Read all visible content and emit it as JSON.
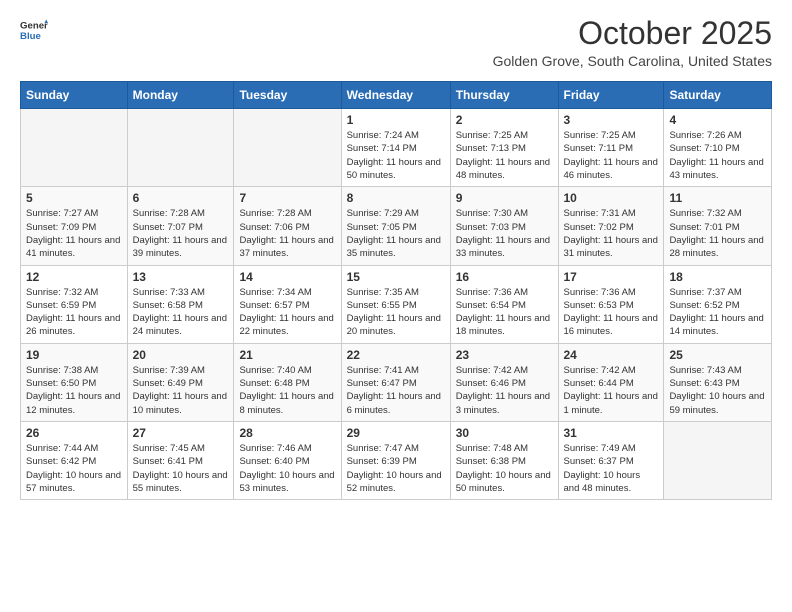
{
  "header": {
    "logo_general": "General",
    "logo_blue": "Blue",
    "title": "October 2025",
    "subtitle": "Golden Grove, South Carolina, United States"
  },
  "weekdays": [
    "Sunday",
    "Monday",
    "Tuesday",
    "Wednesday",
    "Thursday",
    "Friday",
    "Saturday"
  ],
  "weeks": [
    [
      {
        "day": "",
        "sunrise": "",
        "sunset": "",
        "daylight": "",
        "empty": true
      },
      {
        "day": "",
        "sunrise": "",
        "sunset": "",
        "daylight": "",
        "empty": true
      },
      {
        "day": "",
        "sunrise": "",
        "sunset": "",
        "daylight": "",
        "empty": true
      },
      {
        "day": "1",
        "sunrise": "Sunrise: 7:24 AM",
        "sunset": "Sunset: 7:14 PM",
        "daylight": "Daylight: 11 hours and 50 minutes."
      },
      {
        "day": "2",
        "sunrise": "Sunrise: 7:25 AM",
        "sunset": "Sunset: 7:13 PM",
        "daylight": "Daylight: 11 hours and 48 minutes."
      },
      {
        "day": "3",
        "sunrise": "Sunrise: 7:25 AM",
        "sunset": "Sunset: 7:11 PM",
        "daylight": "Daylight: 11 hours and 46 minutes."
      },
      {
        "day": "4",
        "sunrise": "Sunrise: 7:26 AM",
        "sunset": "Sunset: 7:10 PM",
        "daylight": "Daylight: 11 hours and 43 minutes."
      }
    ],
    [
      {
        "day": "5",
        "sunrise": "Sunrise: 7:27 AM",
        "sunset": "Sunset: 7:09 PM",
        "daylight": "Daylight: 11 hours and 41 minutes."
      },
      {
        "day": "6",
        "sunrise": "Sunrise: 7:28 AM",
        "sunset": "Sunset: 7:07 PM",
        "daylight": "Daylight: 11 hours and 39 minutes."
      },
      {
        "day": "7",
        "sunrise": "Sunrise: 7:28 AM",
        "sunset": "Sunset: 7:06 PM",
        "daylight": "Daylight: 11 hours and 37 minutes."
      },
      {
        "day": "8",
        "sunrise": "Sunrise: 7:29 AM",
        "sunset": "Sunset: 7:05 PM",
        "daylight": "Daylight: 11 hours and 35 minutes."
      },
      {
        "day": "9",
        "sunrise": "Sunrise: 7:30 AM",
        "sunset": "Sunset: 7:03 PM",
        "daylight": "Daylight: 11 hours and 33 minutes."
      },
      {
        "day": "10",
        "sunrise": "Sunrise: 7:31 AM",
        "sunset": "Sunset: 7:02 PM",
        "daylight": "Daylight: 11 hours and 31 minutes."
      },
      {
        "day": "11",
        "sunrise": "Sunrise: 7:32 AM",
        "sunset": "Sunset: 7:01 PM",
        "daylight": "Daylight: 11 hours and 28 minutes."
      }
    ],
    [
      {
        "day": "12",
        "sunrise": "Sunrise: 7:32 AM",
        "sunset": "Sunset: 6:59 PM",
        "daylight": "Daylight: 11 hours and 26 minutes."
      },
      {
        "day": "13",
        "sunrise": "Sunrise: 7:33 AM",
        "sunset": "Sunset: 6:58 PM",
        "daylight": "Daylight: 11 hours and 24 minutes."
      },
      {
        "day": "14",
        "sunrise": "Sunrise: 7:34 AM",
        "sunset": "Sunset: 6:57 PM",
        "daylight": "Daylight: 11 hours and 22 minutes."
      },
      {
        "day": "15",
        "sunrise": "Sunrise: 7:35 AM",
        "sunset": "Sunset: 6:55 PM",
        "daylight": "Daylight: 11 hours and 20 minutes."
      },
      {
        "day": "16",
        "sunrise": "Sunrise: 7:36 AM",
        "sunset": "Sunset: 6:54 PM",
        "daylight": "Daylight: 11 hours and 18 minutes."
      },
      {
        "day": "17",
        "sunrise": "Sunrise: 7:36 AM",
        "sunset": "Sunset: 6:53 PM",
        "daylight": "Daylight: 11 hours and 16 minutes."
      },
      {
        "day": "18",
        "sunrise": "Sunrise: 7:37 AM",
        "sunset": "Sunset: 6:52 PM",
        "daylight": "Daylight: 11 hours and 14 minutes."
      }
    ],
    [
      {
        "day": "19",
        "sunrise": "Sunrise: 7:38 AM",
        "sunset": "Sunset: 6:50 PM",
        "daylight": "Daylight: 11 hours and 12 minutes."
      },
      {
        "day": "20",
        "sunrise": "Sunrise: 7:39 AM",
        "sunset": "Sunset: 6:49 PM",
        "daylight": "Daylight: 11 hours and 10 minutes."
      },
      {
        "day": "21",
        "sunrise": "Sunrise: 7:40 AM",
        "sunset": "Sunset: 6:48 PM",
        "daylight": "Daylight: 11 hours and 8 minutes."
      },
      {
        "day": "22",
        "sunrise": "Sunrise: 7:41 AM",
        "sunset": "Sunset: 6:47 PM",
        "daylight": "Daylight: 11 hours and 6 minutes."
      },
      {
        "day": "23",
        "sunrise": "Sunrise: 7:42 AM",
        "sunset": "Sunset: 6:46 PM",
        "daylight": "Daylight: 11 hours and 3 minutes."
      },
      {
        "day": "24",
        "sunrise": "Sunrise: 7:42 AM",
        "sunset": "Sunset: 6:44 PM",
        "daylight": "Daylight: 11 hours and 1 minute."
      },
      {
        "day": "25",
        "sunrise": "Sunrise: 7:43 AM",
        "sunset": "Sunset: 6:43 PM",
        "daylight": "Daylight: 10 hours and 59 minutes."
      }
    ],
    [
      {
        "day": "26",
        "sunrise": "Sunrise: 7:44 AM",
        "sunset": "Sunset: 6:42 PM",
        "daylight": "Daylight: 10 hours and 57 minutes."
      },
      {
        "day": "27",
        "sunrise": "Sunrise: 7:45 AM",
        "sunset": "Sunset: 6:41 PM",
        "daylight": "Daylight: 10 hours and 55 minutes."
      },
      {
        "day": "28",
        "sunrise": "Sunrise: 7:46 AM",
        "sunset": "Sunset: 6:40 PM",
        "daylight": "Daylight: 10 hours and 53 minutes."
      },
      {
        "day": "29",
        "sunrise": "Sunrise: 7:47 AM",
        "sunset": "Sunset: 6:39 PM",
        "daylight": "Daylight: 10 hours and 52 minutes."
      },
      {
        "day": "30",
        "sunrise": "Sunrise: 7:48 AM",
        "sunset": "Sunset: 6:38 PM",
        "daylight": "Daylight: 10 hours and 50 minutes."
      },
      {
        "day": "31",
        "sunrise": "Sunrise: 7:49 AM",
        "sunset": "Sunset: 6:37 PM",
        "daylight": "Daylight: 10 hours and 48 minutes."
      },
      {
        "day": "",
        "sunrise": "",
        "sunset": "",
        "daylight": "",
        "empty": true
      }
    ]
  ]
}
